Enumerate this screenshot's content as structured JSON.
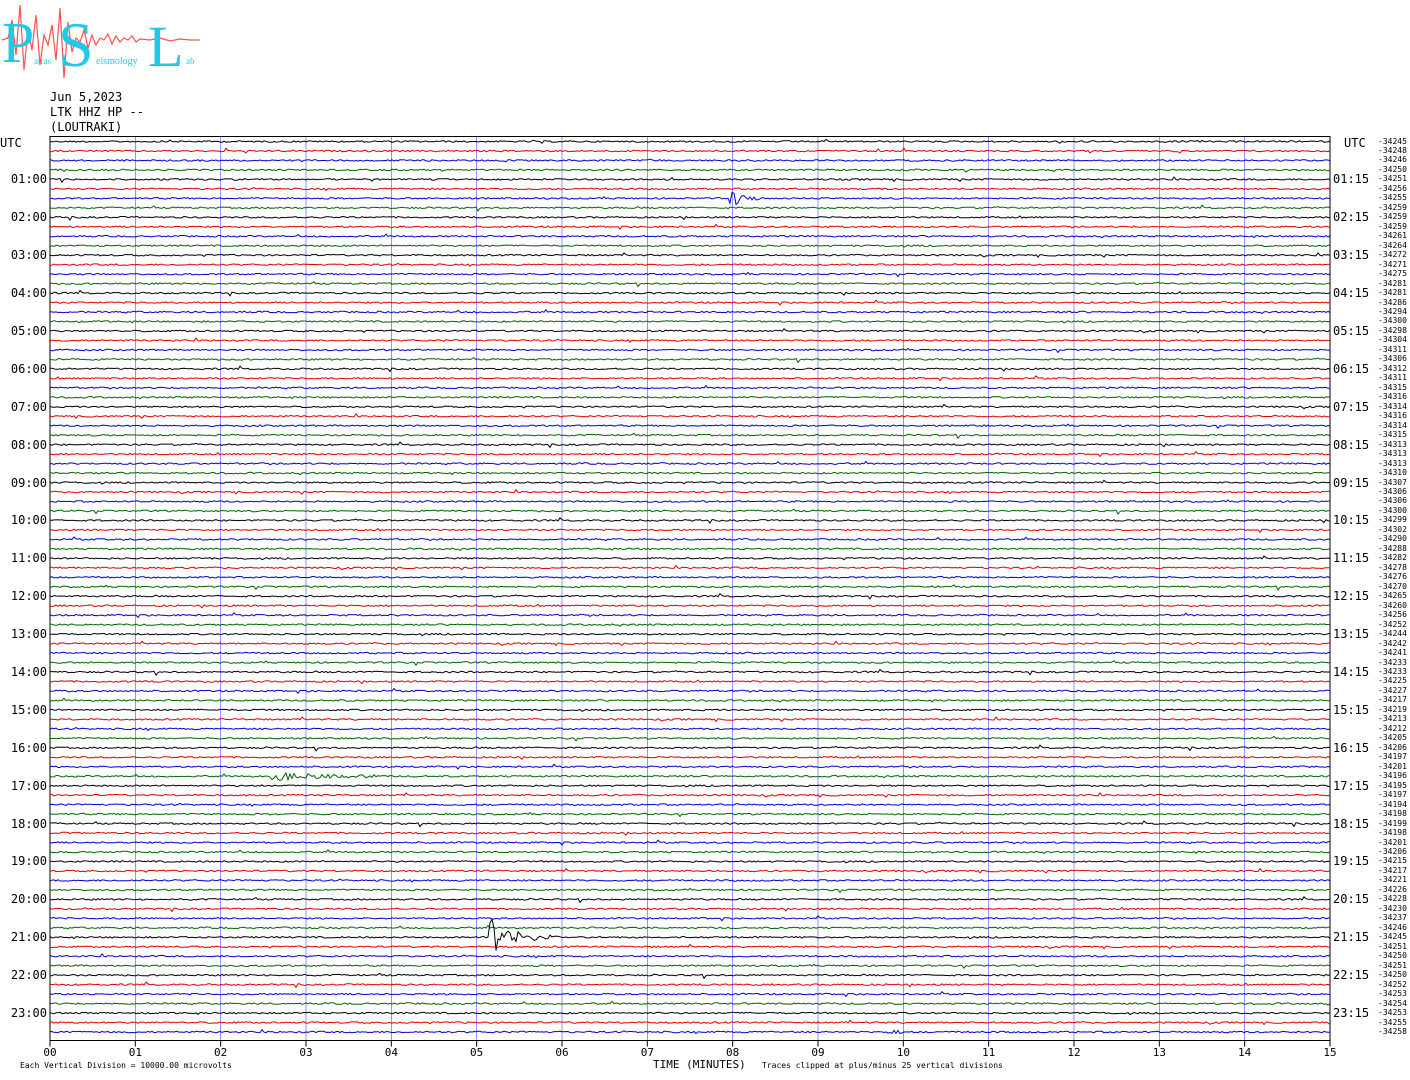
{
  "header": {
    "date": "Jun 5,2023",
    "station": "LTK HHZ HP --",
    "location": "(LOUTRAKI)"
  },
  "logo": {
    "letters": [
      "P",
      "S",
      "L"
    ],
    "small": [
      "atras",
      "eismology",
      "ab"
    ]
  },
  "corner_labels": {
    "left": "UTC",
    "right": "UTC"
  },
  "colors": {
    "black": "#000000",
    "red": "#dd0000",
    "blue": "#0000cc",
    "green": "#006600",
    "grid": "#0000ff",
    "logo_cyan": "#22c8e6",
    "logo_red": "#ff5050"
  },
  "chart_data": {
    "type": "line",
    "xlabel": "TIME (MINUTES)",
    "xlim": [
      0,
      15
    ],
    "x_ticks": [
      "00",
      "01",
      "02",
      "03",
      "04",
      "05",
      "06",
      "07",
      "08",
      "09",
      "10",
      "11",
      "12",
      "13",
      "14",
      "15"
    ],
    "trace_color_cycle": [
      "black",
      "red",
      "blue",
      "green"
    ],
    "left_hour_labels": [
      "01:00",
      "02:00",
      "03:00",
      "04:00",
      "05:00",
      "06:00",
      "07:00",
      "08:00",
      "09:00",
      "10:00",
      "11:00",
      "12:00",
      "13:00",
      "14:00",
      "15:00",
      "16:00",
      "17:00",
      "18:00",
      "19:00",
      "20:00",
      "21:00",
      "22:00",
      "23:00"
    ],
    "right_hour_labels": [
      "01:15",
      "02:15",
      "03:15",
      "04:15",
      "05:15",
      "06:15",
      "07:15",
      "08:15",
      "09:15",
      "10:15",
      "11:15",
      "12:15",
      "13:15",
      "14:15",
      "15:15",
      "16:15",
      "17:15",
      "18:15",
      "19:15",
      "20:15",
      "21:15",
      "22:15",
      "23:15"
    ],
    "trace_values": [
      "-34245",
      "-34248",
      "-34246",
      "-34250",
      "-34251",
      "-34256",
      "-34255",
      "-34259",
      "-34259",
      "-34259",
      "-34261",
      "-34264",
      "-34272",
      "-34271",
      "-34275",
      "-34281",
      "-34281",
      "-34286",
      "-34294",
      "-34300",
      "-34298",
      "-34304",
      "-34311",
      "-34306",
      "-34312",
      "-34311",
      "-34315",
      "-34316",
      "-34314",
      "-34316",
      "-34314",
      "-34315",
      "-34313",
      "-34313",
      "-34313",
      "-34310",
      "-34307",
      "-34306",
      "-34306",
      "-34300",
      "-34299",
      "-34302",
      "-34290",
      "-34288",
      "-34282",
      "-34278",
      "-34276",
      "-34270",
      "-34265",
      "-34260",
      "-34256",
      "-34252",
      "-34244",
      "-34242",
      "-34241",
      "-34233",
      "-34233",
      "-34225",
      "-34227",
      "-34217",
      "-34219",
      "-34213",
      "-34212",
      "-34205",
      "-34206",
      "-34197",
      "-34201",
      "-34196",
      "-34195",
      "-34197",
      "-34194",
      "-34198",
      "-34199",
      "-34198",
      "-34201",
      "-34206",
      "-34215",
      "-34217",
      "-34221",
      "-34226",
      "-34228",
      "-34230",
      "-34237",
      "-34246",
      "-34245",
      "-34251",
      "-34250",
      "-34251",
      "-34250",
      "-34252",
      "-34253",
      "-34254",
      "-34253",
      "-34255",
      "-34258"
    ],
    "events": [
      {
        "trace": 6,
        "t_start": 7.95,
        "t_end": 8.3,
        "amplitude": 1.0
      },
      {
        "trace": 67,
        "t_start": 2.6,
        "t_end": 3.9,
        "amplitude": 0.3
      },
      {
        "trace": 84,
        "t_start": 5.15,
        "t_end": 6.0,
        "amplitude": 1.6
      },
      {
        "trace": 94,
        "t_start": 9.8,
        "t_end": 10.0,
        "amplitude": 0.15
      }
    ]
  },
  "footer": {
    "left": "Each Vertical Division = 10000.00 microvolts",
    "right": "Traces clipped at plus/minus 25 vertical divisions"
  }
}
